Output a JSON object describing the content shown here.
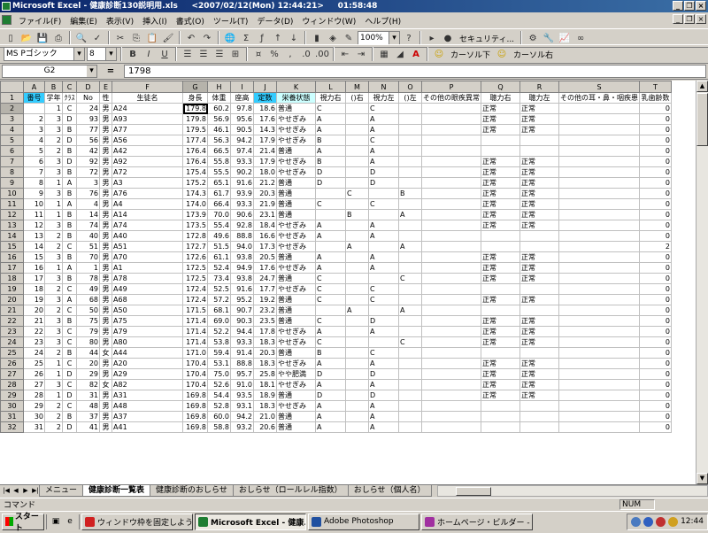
{
  "title": {
    "app": "Microsoft Excel - 健康診断130説明用.xls",
    "date": "<2007/02/12(Mon) 12:44:21>",
    "time": "01:58:48"
  },
  "menu": [
    "ファイル(F)",
    "編集(E)",
    "表示(V)",
    "挿入(I)",
    "書式(O)",
    "ツール(T)",
    "データ(D)",
    "ウィンドウ(W)",
    "ヘルプ(H)"
  ],
  "toolbar1": {
    "zoom": "100%",
    "security": "セキュリティ..."
  },
  "toolbar2": {
    "font": "MS Pゴシック",
    "size": "8",
    "bold": "B",
    "italic": "I",
    "underline": "U",
    "cursor_down": "カーソル下",
    "cursor_right": "カーソル右"
  },
  "formula_bar": {
    "cell": "G2",
    "value": "1798"
  },
  "columns": [
    "A",
    "B",
    "C",
    "D",
    "E",
    "F",
    "G",
    "H",
    "I",
    "J",
    "K",
    "L",
    "M",
    "N",
    "O",
    "P",
    "Q",
    "R",
    "S",
    "T"
  ],
  "headers": [
    "番号",
    "学年",
    "ｸﾗｽ",
    "No",
    "性",
    "生徒名",
    "身長",
    "体重",
    "座高",
    "定数",
    "栄養状態",
    "視力右",
    "()右",
    "視力左",
    "()左",
    "その他の眼疾異常",
    "聴力右",
    "聴力左",
    "その他の耳・鼻・咽疾患",
    "乳歯齢数"
  ],
  "rows": [
    [
      "",
      "",
      "1",
      "C",
      "24",
      "男",
      "A24",
      "179.8",
      "60.2",
      "97.8",
      "18.6",
      "普通",
      "C",
      "",
      "C",
      "",
      "",
      "正常",
      "正常",
      "",
      "0"
    ],
    [
      "",
      "2",
      "3",
      "D",
      "93",
      "男",
      "A93",
      "179.8",
      "56.9",
      "95.6",
      "17.6",
      "やせぎみ",
      "A",
      "",
      "A",
      "",
      "",
      "正常",
      "正常",
      "",
      "0"
    ],
    [
      "",
      "3",
      "3",
      "B",
      "77",
      "男",
      "A77",
      "179.5",
      "46.1",
      "90.5",
      "14.3",
      "やせぎみ",
      "A",
      "",
      "A",
      "",
      "",
      "正常",
      "正常",
      "",
      "0"
    ],
    [
      "",
      "4",
      "2",
      "D",
      "56",
      "男",
      "A56",
      "177.4",
      "56.3",
      "94.2",
      "17.9",
      "やせぎみ",
      "B",
      "",
      "C",
      "",
      "",
      "",
      "",
      "",
      "0"
    ],
    [
      "",
      "5",
      "2",
      "B",
      "42",
      "男",
      "A42",
      "176.4",
      "66.5",
      "97.4",
      "21.4",
      "普通",
      "A",
      "",
      "A",
      "",
      "",
      "",
      "",
      "",
      "0"
    ],
    [
      "",
      "6",
      "3",
      "D",
      "92",
      "男",
      "A92",
      "176.4",
      "55.8",
      "93.3",
      "17.9",
      "やせぎみ",
      "B",
      "",
      "A",
      "",
      "",
      "正常",
      "正常",
      "",
      "0"
    ],
    [
      "",
      "7",
      "3",
      "B",
      "72",
      "男",
      "A72",
      "175.4",
      "55.5",
      "90.2",
      "18.0",
      "やせぎみ",
      "D",
      "",
      "D",
      "",
      "",
      "正常",
      "正常",
      "",
      "0"
    ],
    [
      "",
      "8",
      "1",
      "A",
      "3",
      "男",
      "A3",
      "175.2",
      "65.1",
      "91.6",
      "21.2",
      "普通",
      "D",
      "",
      "D",
      "",
      "",
      "正常",
      "正常",
      "",
      "0"
    ],
    [
      "",
      "9",
      "3",
      "B",
      "76",
      "男",
      "A76",
      "174.3",
      "61.7",
      "93.9",
      "20.3",
      "普通",
      "",
      "C",
      "",
      "B",
      "",
      "正常",
      "正常",
      "",
      "0"
    ],
    [
      "",
      "10",
      "1",
      "A",
      "4",
      "男",
      "A4",
      "174.0",
      "66.4",
      "93.3",
      "21.9",
      "普通",
      "C",
      "",
      "C",
      "",
      "",
      "正常",
      "正常",
      "",
      "0"
    ],
    [
      "",
      "11",
      "1",
      "B",
      "14",
      "男",
      "A14",
      "173.9",
      "70.0",
      "90.6",
      "23.1",
      "普通",
      "",
      "B",
      "",
      "A",
      "",
      "正常",
      "正常",
      "",
      "0"
    ],
    [
      "",
      "12",
      "3",
      "B",
      "74",
      "男",
      "A74",
      "173.5",
      "55.4",
      "92.8",
      "18.4",
      "やせぎみ",
      "A",
      "",
      "A",
      "",
      "",
      "正常",
      "正常",
      "",
      "0"
    ],
    [
      "",
      "13",
      "2",
      "B",
      "40",
      "男",
      "A40",
      "172.8",
      "49.6",
      "88.8",
      "16.6",
      "やせぎみ",
      "A",
      "",
      "A",
      "",
      "",
      "",
      "",
      "",
      "0"
    ],
    [
      "",
      "14",
      "2",
      "C",
      "51",
      "男",
      "A51",
      "172.7",
      "51.5",
      "94.0",
      "17.3",
      "やせぎみ",
      "",
      "A",
      "",
      "A",
      "",
      "",
      "",
      "",
      "2"
    ],
    [
      "",
      "15",
      "3",
      "B",
      "70",
      "男",
      "A70",
      "172.6",
      "61.1",
      "93.8",
      "20.5",
      "普通",
      "A",
      "",
      "A",
      "",
      "",
      "正常",
      "正常",
      "",
      "0"
    ],
    [
      "",
      "16",
      "1",
      "A",
      "1",
      "男",
      "A1",
      "172.5",
      "52.4",
      "94.9",
      "17.6",
      "やせぎみ",
      "A",
      "",
      "A",
      "",
      "",
      "正常",
      "正常",
      "",
      "0"
    ],
    [
      "",
      "17",
      "3",
      "B",
      "78",
      "男",
      "A78",
      "172.5",
      "73.4",
      "93.8",
      "24.7",
      "普通",
      "C",
      "",
      "",
      "C",
      "",
      "正常",
      "正常",
      "",
      "0"
    ],
    [
      "",
      "18",
      "2",
      "C",
      "49",
      "男",
      "A49",
      "172.4",
      "52.5",
      "91.6",
      "17.7",
      "やせぎみ",
      "C",
      "",
      "C",
      "",
      "",
      "",
      "",
      "",
      "0"
    ],
    [
      "",
      "19",
      "3",
      "A",
      "68",
      "男",
      "A68",
      "172.4",
      "57.2",
      "95.2",
      "19.2",
      "普通",
      "C",
      "",
      "C",
      "",
      "",
      "正常",
      "正常",
      "",
      "0"
    ],
    [
      "",
      "20",
      "2",
      "C",
      "50",
      "男",
      "A50",
      "171.5",
      "68.1",
      "90.7",
      "23.2",
      "普通",
      "",
      "A",
      "",
      "A",
      "",
      "",
      "",
      "",
      "0"
    ],
    [
      "",
      "21",
      "3",
      "B",
      "75",
      "男",
      "A75",
      "171.4",
      "69.0",
      "90.3",
      "23.5",
      "普通",
      "C",
      "",
      "D",
      "",
      "",
      "正常",
      "正常",
      "",
      "0"
    ],
    [
      "",
      "22",
      "3",
      "C",
      "79",
      "男",
      "A79",
      "171.4",
      "52.2",
      "94.4",
      "17.8",
      "やせぎみ",
      "A",
      "",
      "A",
      "",
      "",
      "正常",
      "正常",
      "",
      "0"
    ],
    [
      "",
      "23",
      "3",
      "C",
      "80",
      "男",
      "A80",
      "171.4",
      "53.8",
      "93.3",
      "18.3",
      "やせぎみ",
      "C",
      "",
      "",
      "C",
      "",
      "正常",
      "正常",
      "",
      "0"
    ],
    [
      "",
      "24",
      "2",
      "B",
      "44",
      "女",
      "A44",
      "171.0",
      "59.4",
      "91.4",
      "20.3",
      "普通",
      "B",
      "",
      "C",
      "",
      "",
      "",
      "",
      "",
      "0"
    ],
    [
      "",
      "25",
      "1",
      "C",
      "20",
      "男",
      "A20",
      "170.4",
      "53.1",
      "88.8",
      "18.3",
      "やせぎみ",
      "A",
      "",
      "A",
      "",
      "",
      "正常",
      "正常",
      "",
      "0"
    ],
    [
      "",
      "26",
      "1",
      "D",
      "29",
      "男",
      "A29",
      "170.4",
      "75.0",
      "95.7",
      "25.8",
      "やや肥満",
      "D",
      "",
      "D",
      "",
      "",
      "正常",
      "正常",
      "",
      "0"
    ],
    [
      "",
      "27",
      "3",
      "C",
      "82",
      "女",
      "A82",
      "170.4",
      "52.6",
      "91.0",
      "18.1",
      "やせぎみ",
      "A",
      "",
      "A",
      "",
      "",
      "正常",
      "正常",
      "",
      "0"
    ],
    [
      "",
      "28",
      "1",
      "D",
      "31",
      "男",
      "A31",
      "169.8",
      "54.4",
      "93.5",
      "18.9",
      "普通",
      "D",
      "",
      "D",
      "",
      "",
      "正常",
      "正常",
      "",
      "0"
    ],
    [
      "",
      "29",
      "2",
      "C",
      "48",
      "男",
      "A48",
      "169.8",
      "52.8",
      "93.1",
      "18.3",
      "やせぎみ",
      "A",
      "",
      "A",
      "",
      "",
      "",
      "",
      "",
      "0"
    ],
    [
      "",
      "30",
      "2",
      "B",
      "37",
      "男",
      "A37",
      "169.8",
      "60.0",
      "94.2",
      "21.0",
      "普通",
      "A",
      "",
      "A",
      "",
      "",
      "",
      "",
      "",
      "0"
    ],
    [
      "",
      "31",
      "2",
      "D",
      "41",
      "男",
      "A41",
      "169.8",
      "58.8",
      "93.2",
      "20.6",
      "普通",
      "A",
      "",
      "A",
      "",
      "",
      "",
      "",
      "",
      "0"
    ]
  ],
  "tabs": [
    "メニュー",
    "健康診断一覧表",
    "健康診断のおしらせ",
    "おしらせ（ロールレル指数）",
    "おしらせ（個人名）"
  ],
  "status": {
    "mode": "コマンド",
    "num": "NUM"
  },
  "taskbar": {
    "start": "スタート",
    "tasks": [
      "ウィンドウ枠を固定しよう -...",
      "Microsoft Excel - 健康...",
      "Adobe Photoshop",
      "ホームページ・ビルダー - [..."
    ],
    "clock": "12:44"
  }
}
